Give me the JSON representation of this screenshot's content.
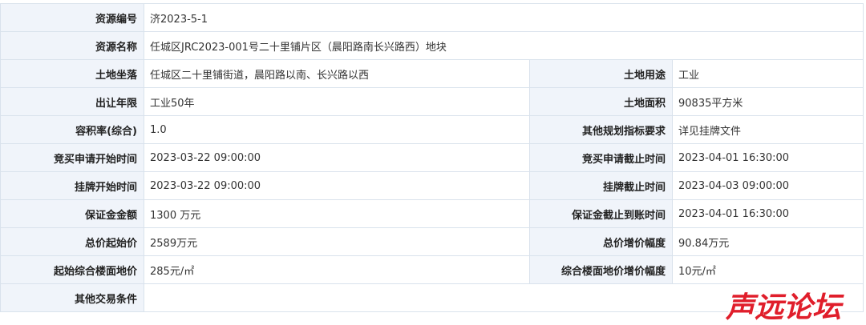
{
  "table": {
    "resource_no": {
      "label": "资源编号",
      "value": "济2023-5-1"
    },
    "resource_name": {
      "label": "资源名称",
      "value": "任城区JRC2023-001号二十里铺片区（晨阳路南长兴路西）地块"
    },
    "location": {
      "label": "土地坐落",
      "value": "任城区二十里铺街道，晨阳路以南、长兴路以西"
    },
    "land_use": {
      "label": "土地用途",
      "value": "工业"
    },
    "term": {
      "label": "出让年限",
      "value": "工业50年"
    },
    "area": {
      "label": "土地面积",
      "value": "90835平方米"
    },
    "far": {
      "label": "容积率(综合)",
      "value": "1.0"
    },
    "other_plan": {
      "label": "其他规划指标要求",
      "value": "详见挂牌文件"
    },
    "bid_start": {
      "label": "竞买申请开始时间",
      "value": "2023-03-22 09:00:00"
    },
    "bid_end": {
      "label": "竞买申请截止时间",
      "value": "2023-04-01 16:30:00"
    },
    "list_start": {
      "label": "挂牌开始时间",
      "value": "2023-03-22 09:00:00"
    },
    "list_end": {
      "label": "挂牌截止时间",
      "value": "2023-04-03 09:00:00"
    },
    "deposit": {
      "label": "保证金金额",
      "value": "1300 万元"
    },
    "deposit_due": {
      "label": "保证金截止到账时间",
      "value": "2023-04-01 16:30:00"
    },
    "start_price": {
      "label": "总价起始价",
      "value": "2589万元"
    },
    "increment": {
      "label": "总价增价幅度",
      "value": "90.84万元"
    },
    "floor_price": {
      "label": "起始综合楼面地价",
      "value": "285元/㎡"
    },
    "floor_increment": {
      "label": "综合楼面地价增价幅度",
      "value": "10元/㎡"
    },
    "other_terms": {
      "label": "其他交易条件",
      "value": ""
    }
  },
  "watermark": {
    "text": "声远论坛",
    "color": "#e01e2b"
  }
}
